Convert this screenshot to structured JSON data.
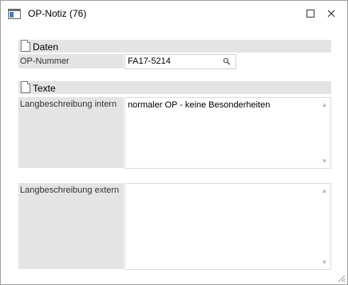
{
  "window": {
    "title": "OP-Notiz (76)"
  },
  "sections": {
    "daten": {
      "label": "Daten"
    },
    "texte": {
      "label": "Texte"
    }
  },
  "fields": {
    "op_nummer": {
      "label": "OP-Nummer",
      "value": "FA17-5214"
    },
    "lang_intern": {
      "label": "Langbeschreibung intern",
      "value": "normaler OP - keine Besonderheiten"
    },
    "lang_extern": {
      "label": "Langbeschreibung extern",
      "value": ""
    }
  },
  "icons": {
    "app": "window-app-icon",
    "maximize": "maximize-icon",
    "close": "close-icon",
    "lookup": "magnifier-icon",
    "section": "document-icon",
    "resize": "resize-grip-icon"
  },
  "colors": {
    "header_bg": "#e4e4e4",
    "accent": "#3d7fc1"
  }
}
